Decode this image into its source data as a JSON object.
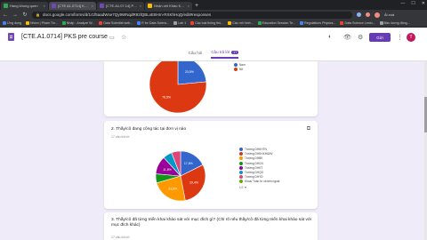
{
  "browser": {
    "tabs": [
      {
        "title": "Hang khong quen",
        "color": "#34a853",
        "active": false
      },
      {
        "title": "[CTE A1.0714] Ket quả pre course",
        "color": "#7248b9",
        "active": true
      },
      {
        "title": "[CTE.A1.07.14] PKS pre course",
        "color": "#7248b9",
        "active": false
      },
      {
        "title": "Nhận xét Khảo Khảo học thương",
        "color": "#fbbc04",
        "active": false
      }
    ],
    "close_glyph": "×",
    "newtab_glyph": "+",
    "window_controls": [
      "—",
      "☐",
      "✕"
    ],
    "back_glyph": "←",
    "forward_glyph": "→",
    "reload_glyph": "↻",
    "lock_glyph": "🔒",
    "url": "docs.google.com/forms/d/1r1f5aadWse7Qy9WNqdR92lQBLxE8Hrn-RXKhHqQ/edit#responses",
    "profile_label": "Ài xoá",
    "bookmarks": [
      {
        "label": "Ứng dụng",
        "color": "#4285f4"
      },
      {
        "label": "Nhóm | Phạm Tin...",
        "color": "#fbbc04"
      },
      {
        "label": "Nhấp - Analyze W...",
        "color": "#34a853"
      },
      {
        "label": "Data Scientist web...",
        "color": "#ea4335"
      },
      {
        "label": "R for Data Scienc...",
        "color": "#4285f4"
      },
      {
        "label": "Lab 1",
        "color": "#9aa0a6"
      },
      {
        "label": "Các loại thông thú...",
        "color": "#ea4335"
      },
      {
        "label": "Các mô hình...",
        "color": "#fbbc04"
      },
      {
        "label": "Education Session Te...",
        "color": "#34a853"
      },
      {
        "label": "Regulations Physics...",
        "color": "#4285f4"
      },
      {
        "label": "Data Science Lectu...",
        "color": "#ea4335"
      },
      {
        "label": "Bảo lương động...",
        "color": "#9aa0a6"
      }
    ]
  },
  "form": {
    "title": "[CTE.A1.0714] PKS pre course",
    "folder_glyph": "▭",
    "star_glyph": "☆",
    "icons": [
      "◐",
      "👁",
      "⚙"
    ],
    "send_label": "Gửi",
    "more_glyph": "⋮",
    "avatar_letter": "T",
    "tabs": {
      "questions": "Câu hỏi",
      "responses": "Câu trả lời",
      "responses_count": "17"
    }
  },
  "card1": {
    "legend": [
      {
        "label": "Nam",
        "color": "#3366cc"
      },
      {
        "label": "Nữ",
        "color": "#dc3912"
      }
    ],
    "labels": [
      "76,5%",
      "23,5%"
    ],
    "chart_data": {
      "type": "pie",
      "categories": [
        "Nam",
        "Nữ"
      ],
      "values": [
        23.5,
        76.5
      ],
      "colors": [
        "#3366cc",
        "#dc3912"
      ]
    }
  },
  "card2": {
    "question": "2. Thầy/cô đang công tác tại đơn vị nào",
    "response_count": "17 câu trả lời",
    "copy_glyph": "⧉",
    "legend": [
      {
        "label": "Trường DHKHTN",
        "color": "#3366cc"
      },
      {
        "label": "Trường DHKHXH&NV",
        "color": "#dc3912"
      },
      {
        "label": "Trường DHBK",
        "color": "#ff9900"
      },
      {
        "label": "Trường DHCN",
        "color": "#109618"
      },
      {
        "label": "Trường DHKT",
        "color": "#990099"
      },
      {
        "label": "Trường DHQG",
        "color": "#0099c6"
      },
      {
        "label": "Trường DHYD",
        "color": "#dd4477"
      },
      {
        "label": "Khoa/ Tuần tư và bên ngoài",
        "color": "#66aa00"
      }
    ],
    "pager": "1/2 ▼",
    "labels": [
      "29,4%",
      "23,5%",
      "17,6%",
      "11,8%"
    ],
    "chart_data": {
      "type": "pie",
      "categories": [
        "Trường DHKHTN",
        "Trường DHKHXH&NV",
        "Trường DHBK",
        "Trường DHCN",
        "Trường DHKT",
        "Trường DHQG",
        "Trường DHYD",
        "Khoa/ Tuần tư và bên ngoài"
      ],
      "values": [
        17.6,
        29.4,
        23.5,
        5.9,
        11.8,
        5.9,
        5.9,
        0
      ],
      "colors": [
        "#3366cc",
        "#dc3912",
        "#ff9900",
        "#109618",
        "#990099",
        "#0099c6",
        "#dd4477",
        "#66aa00"
      ]
    }
  },
  "card3": {
    "question": "3. Thầy/cô đã từng triển khai khảo sát với mục đích gì? (Chỉ rõ nếu thầy/cô đã từng triển khai khảo sát với mục đích khác)",
    "response_count": "17 câu trả lời"
  }
}
